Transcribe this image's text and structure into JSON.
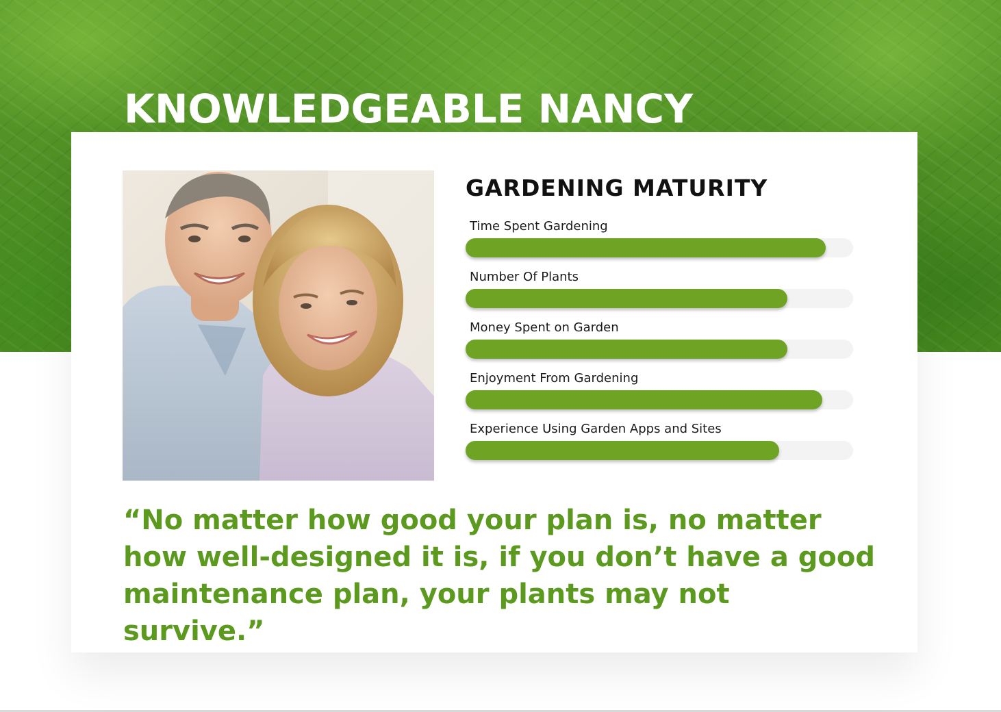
{
  "page": {
    "title": "KNOWLEDGEABLE NANCY"
  },
  "photo": {
    "icon": "couple-portrait-photo"
  },
  "maturity": {
    "title": "GARDENING MATURITY",
    "bar_color": "#6ea324",
    "track_color": "#f3f3f3",
    "metrics": [
      {
        "label": "Time Spent Gardening",
        "value": 0.93
      },
      {
        "label": "Number Of Plants",
        "value": 0.83
      },
      {
        "label": "Money Spent on Garden",
        "value": 0.83
      },
      {
        "label": "Enjoyment From Gardening",
        "value": 0.92
      },
      {
        "label": "Experience Using Garden Apps and Sites",
        "value": 0.81
      }
    ]
  },
  "quote": {
    "text": "“No matter how good your plan is, no matter how well-designed it is, if you don’t have a good maintenance plan, your plants may not survive.”",
    "color": "#5b9a1e"
  },
  "colors": {
    "hero_green": "#4f8f24",
    "title_text": "#ffffff"
  }
}
